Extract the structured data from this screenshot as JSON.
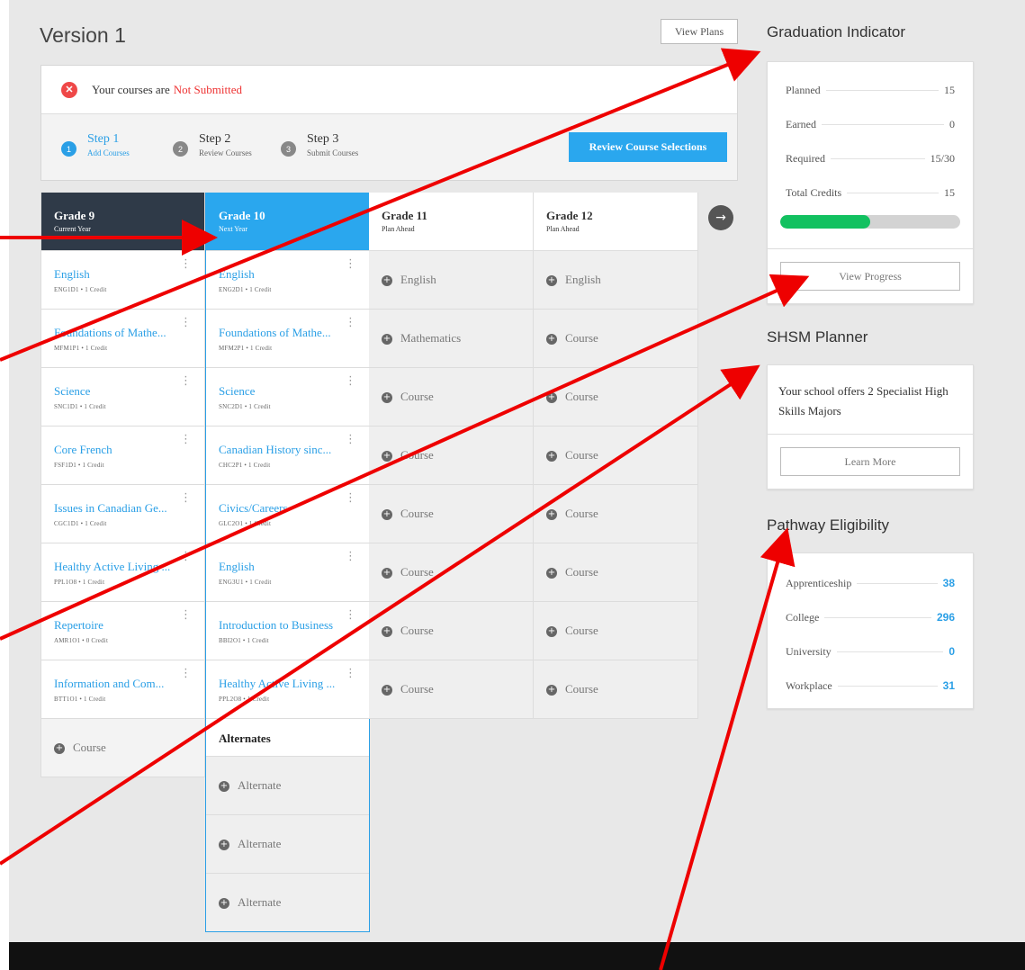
{
  "page": {
    "title": "Version 1",
    "view_plans": "View Plans"
  },
  "status": {
    "prefix": "Your courses are",
    "state": "Not Submitted",
    "x_icon": "✕"
  },
  "steps": [
    {
      "num": "1",
      "title": "Step 1",
      "sub": "Add Courses"
    },
    {
      "num": "2",
      "title": "Step 2",
      "sub": "Review Courses"
    },
    {
      "num": "3",
      "title": "Step 3",
      "sub": "Submit Courses"
    }
  ],
  "review_button": "Review Course Selections",
  "plus_glyph": "+",
  "arrow_glyph": "→",
  "kebab_glyph": "⋮",
  "grades": [
    {
      "title": "Grade 9",
      "sub": "Current Year",
      "courses": [
        {
          "name": "English",
          "code": "ENG1D1 • 1 Credit"
        },
        {
          "name": "Foundations of Mathe...",
          "code": "MFM1P1 • 1 Credit"
        },
        {
          "name": "Science",
          "code": "SNC1D1 • 1 Credit"
        },
        {
          "name": "Core French",
          "code": "FSF1D1 • 1 Credit"
        },
        {
          "name": "Issues in Canadian Ge...",
          "code": "CGC1D1 • 1 Credit"
        },
        {
          "name": "Healthy Active Living ...",
          "code": "PPL1O8 • 1 Credit"
        },
        {
          "name": "Repertoire",
          "code": "AMR1O1 • 0 Credit"
        },
        {
          "name": "Information and Com...",
          "code": "BTT1O1 • 1 Credit"
        }
      ],
      "add": "Course"
    },
    {
      "title": "Grade 10",
      "sub": "Next Year",
      "courses": [
        {
          "name": "English",
          "code": "ENG2D1 • 1 Credit"
        },
        {
          "name": "Foundations of Mathe...",
          "code": "MFM2P1 • 1 Credit"
        },
        {
          "name": "Science",
          "code": "SNC2D1 • 1 Credit"
        },
        {
          "name": "Canadian History sinc...",
          "code": "CHC2P1 • 1 Credit"
        },
        {
          "name": "Civics/Careers",
          "code": "GLC2O1 • 1 Credit"
        },
        {
          "name": "English",
          "code": "ENG3U1 • 1 Credit"
        },
        {
          "name": "Introduction to Business",
          "code": "BBI2O1 • 1 Credit"
        },
        {
          "name": "Healthy Active Living ...",
          "code": "PPL2O8 • 1 Credit"
        }
      ],
      "alternates_title": "Alternates",
      "alternates": [
        "Alternate",
        "Alternate",
        "Alternate"
      ]
    },
    {
      "title": "Grade 11",
      "sub": "Plan Ahead",
      "slots": [
        "English",
        "Mathematics",
        "Course",
        "Course",
        "Course",
        "Course",
        "Course",
        "Course"
      ]
    },
    {
      "title": "Grade 12",
      "sub": "Plan Ahead",
      "slots": [
        "English",
        "Course",
        "Course",
        "Course",
        "Course",
        "Course",
        "Course",
        "Course"
      ]
    }
  ],
  "graduation": {
    "title": "Graduation Indicator",
    "rows": [
      {
        "label": "Planned",
        "value": "15"
      },
      {
        "label": "Earned",
        "value": "0"
      },
      {
        "label": "Required",
        "value": "15/30"
      },
      {
        "label": "Total Credits",
        "value": "15"
      }
    ],
    "progress_fraction": 0.5,
    "progress_color": "#12c160",
    "button": "View Progress"
  },
  "shsm": {
    "title": "SHSM Planner",
    "text": "Your school offers 2 Specialist High Skills Majors",
    "button": "Learn More"
  },
  "pathway": {
    "title": "Pathway Eligibility",
    "rows": [
      {
        "label": "Apprenticeship",
        "value": "38"
      },
      {
        "label": "College",
        "value": "296"
      },
      {
        "label": "University",
        "value": "0"
      },
      {
        "label": "Workplace",
        "value": "31"
      }
    ]
  },
  "colors": {
    "accent": "#2aa7ee",
    "dark_header": "#2f3a48",
    "error": "#ee3333",
    "annotation": "#ee0000"
  }
}
